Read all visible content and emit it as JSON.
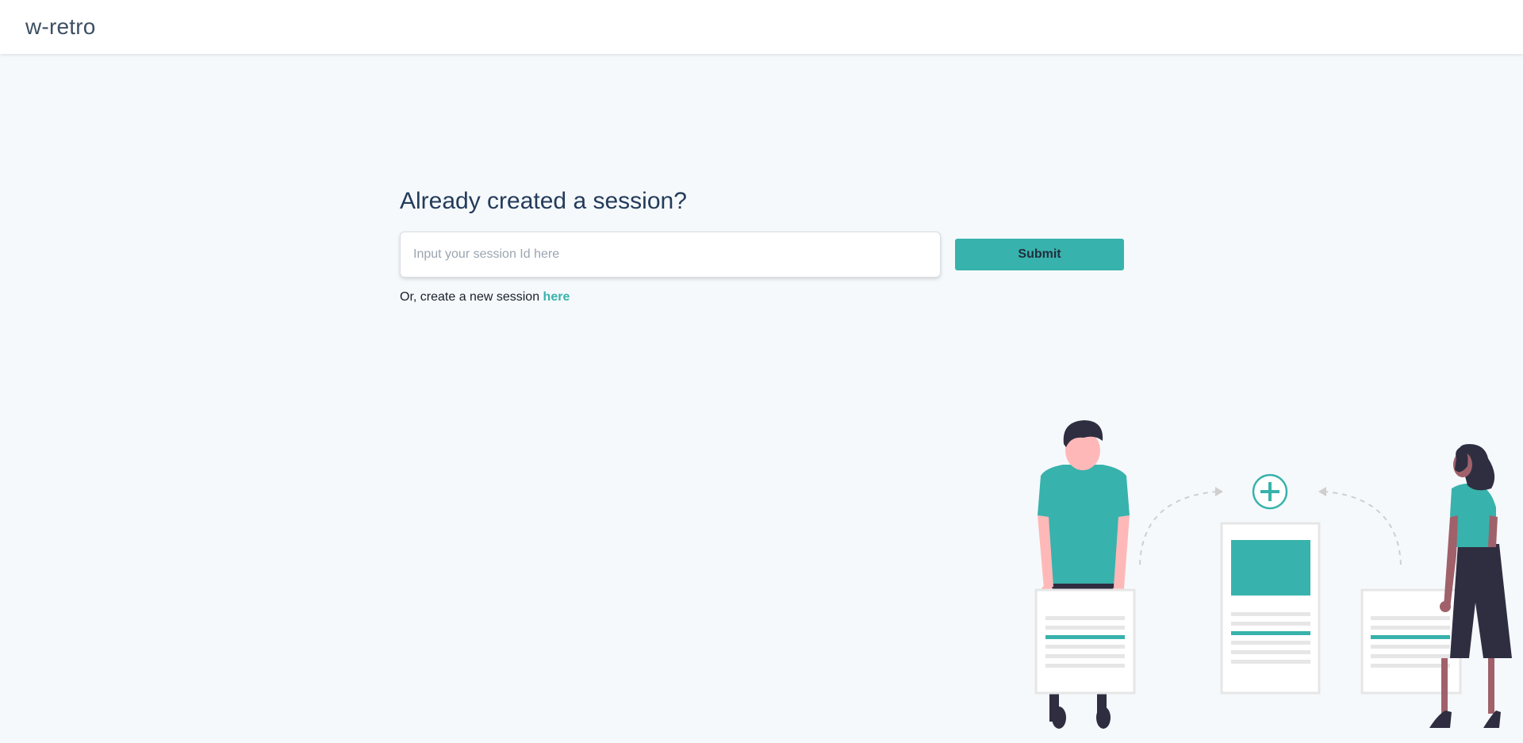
{
  "navbar": {
    "brand": "w-retro"
  },
  "session": {
    "heading": "Already created a session?",
    "input_placeholder": "Input your session Id here",
    "input_value": "",
    "submit_label": "Submit",
    "create_prefix": "Or, create a new session",
    "create_link_label": "here"
  },
  "colors": {
    "accent": "#38b2ac",
    "background": "#f5f9fb",
    "heading": "#243b5a",
    "figure_dark": "#2f2e41",
    "skin_light": "#ffb8b8",
    "skin_dark": "#a0616a",
    "doc_line": "#e6e6e6"
  },
  "illustration": {
    "name": "collaboration-people-documents",
    "icons": [
      "plus-circle-icon",
      "dashed-arrow-icon"
    ]
  }
}
